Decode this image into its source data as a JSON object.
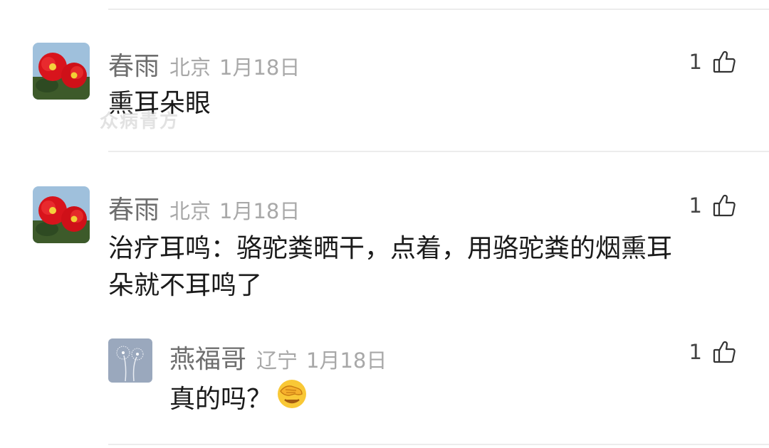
{
  "comments": [
    {
      "username": "春雨",
      "location": "北京",
      "date": "1月18日",
      "likes": "1",
      "text": "熏耳朵眼",
      "avatar_icon": "red-camellia-avatar"
    },
    {
      "username": "春雨",
      "location": "北京",
      "date": "1月18日",
      "likes": "1",
      "text_line1": "治疗耳鸣：骆驼粪晒干，点着，用骆驼粪的烟熏耳",
      "text_line2": "朵就不耳鸣了",
      "avatar_icon": "red-camellia-avatar"
    }
  ],
  "reply": {
    "username": "燕福哥",
    "location": "辽宁",
    "date": "1月18日",
    "likes": "1",
    "text": "真的吗？",
    "emoji": "face-with-hand-over-eyes-emoji",
    "avatar_icon": "dandelion-avatar"
  },
  "watermark": "众病青方",
  "colors": {
    "username": "#6e6e6e",
    "meta": "#a8a8a8",
    "text": "#1a1a1a",
    "divider": "#ececec"
  }
}
